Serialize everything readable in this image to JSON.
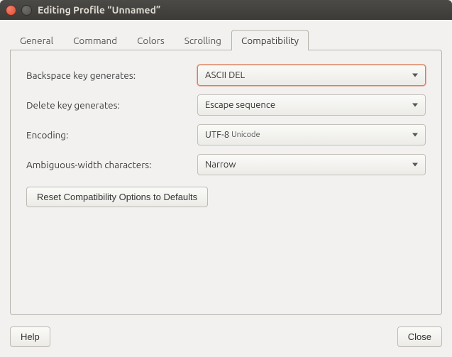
{
  "colors": {
    "accent": "#df7c55"
  },
  "window": {
    "title": "Editing Profile “Unnamed”"
  },
  "tabs": [
    {
      "label": "General",
      "active": false
    },
    {
      "label": "Command",
      "active": false
    },
    {
      "label": "Colors",
      "active": false
    },
    {
      "label": "Scrolling",
      "active": false
    },
    {
      "label": "Compatibility",
      "active": true
    }
  ],
  "compat": {
    "backspace": {
      "label": "Backspace key generates:",
      "value": "ASCII DEL"
    },
    "delete": {
      "label": "Delete key generates:",
      "value": "Escape sequence"
    },
    "encoding": {
      "label": "Encoding:",
      "value_main": "UTF-8",
      "value_sub": "Unicode"
    },
    "ambiguous": {
      "label": "Ambiguous-width characters:",
      "value": "Narrow"
    },
    "reset_label": "Reset Compatibility Options to Defaults"
  },
  "buttons": {
    "help": "Help",
    "close": "Close"
  }
}
